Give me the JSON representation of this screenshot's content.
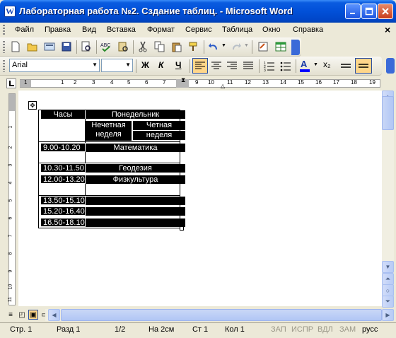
{
  "window": {
    "title": "Лабораторная работа №2. Сздание таблиц. - Microsoft Word",
    "app_icon_letter": "W"
  },
  "menu": {
    "items": [
      "Файл",
      "Правка",
      "Вид",
      "Вставка",
      "Формат",
      "Сервис",
      "Таблица",
      "Окно",
      "Справка"
    ],
    "close_doc": "×"
  },
  "format_toolbar": {
    "font": "Arial",
    "size": "",
    "bold": "Ж",
    "italic": "К",
    "underline": "Ч",
    "subscript": "x₂",
    "font_color_letter": "А"
  },
  "ruler": {
    "numbers": [
      "1",
      "1",
      "2",
      "3",
      "4",
      "5",
      "6",
      "7",
      "8",
      "9",
      "10",
      "11",
      "12",
      "13",
      "14",
      "15",
      "16",
      "17",
      "18",
      "19"
    ],
    "vnumbers": [
      "1",
      "2",
      "3",
      "4",
      "5",
      "6",
      "7",
      "8",
      "9",
      "10",
      "11"
    ]
  },
  "table": {
    "move_handle": "✥",
    "header_hours": "Часы",
    "header_day": "Понедельник",
    "sub_odd": [
      "Нечетная",
      "неделя"
    ],
    "sub_even": [
      "Четная",
      "неделя"
    ],
    "rows": [
      {
        "time": "9.00-10.20",
        "subject": "Математика"
      },
      {
        "time": "10.30-11.50",
        "subject": "Геодезия"
      },
      {
        "time": "12.00-13.20",
        "subject": "Физкультура"
      },
      {
        "time": "13.50-15.10",
        "subject": ""
      },
      {
        "time": "15.20-16.40",
        "subject": ""
      },
      {
        "time": "16.50-18.10",
        "subject": ""
      }
    ]
  },
  "status": {
    "page": "Стр.  1",
    "section": "Разд  1",
    "pages": "1/2",
    "at": "На  2см",
    "line": "Ст  1",
    "col": "Кол  1",
    "rec": "ЗАП",
    "trk": "ИСПР",
    "ext": "ВДЛ",
    "ovr": "ЗАМ",
    "lang": "русс"
  },
  "colors": {
    "titlebar": "#0150d8",
    "font_color_bar": "#ff0000",
    "highlight": "#ffcc66"
  }
}
